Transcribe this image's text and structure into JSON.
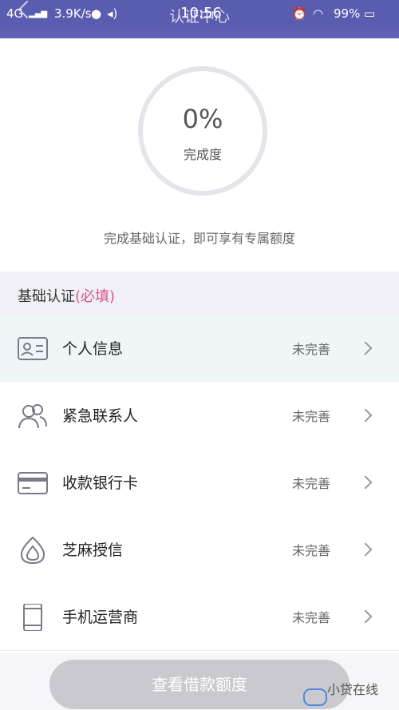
{
  "statusbar": {
    "network": "4G",
    "speed": "3.9K/s",
    "time": "10:56",
    "battery": "99%"
  },
  "header": {
    "title": "认证中心"
  },
  "progress": {
    "percent_text": "0%",
    "percent_value": 0,
    "label": "完成度"
  },
  "tip": "完成基础认证，即可享有专属额度",
  "section": {
    "title": "基础认证",
    "required": "(必填)"
  },
  "items": [
    {
      "label": "个人信息",
      "status": "未完善",
      "icon": "id-card-icon"
    },
    {
      "label": "紧急联系人",
      "status": "未完善",
      "icon": "contacts-icon"
    },
    {
      "label": "收款银行卡",
      "status": "未完善",
      "icon": "bank-card-icon"
    },
    {
      "label": "芝麻授信",
      "status": "未完善",
      "icon": "sesame-icon"
    },
    {
      "label": "手机运营商",
      "status": "未完善",
      "icon": "phone-icon"
    }
  ],
  "cta": {
    "label": "查看借款额度"
  },
  "watermark": {
    "text": "小贷在线"
  }
}
